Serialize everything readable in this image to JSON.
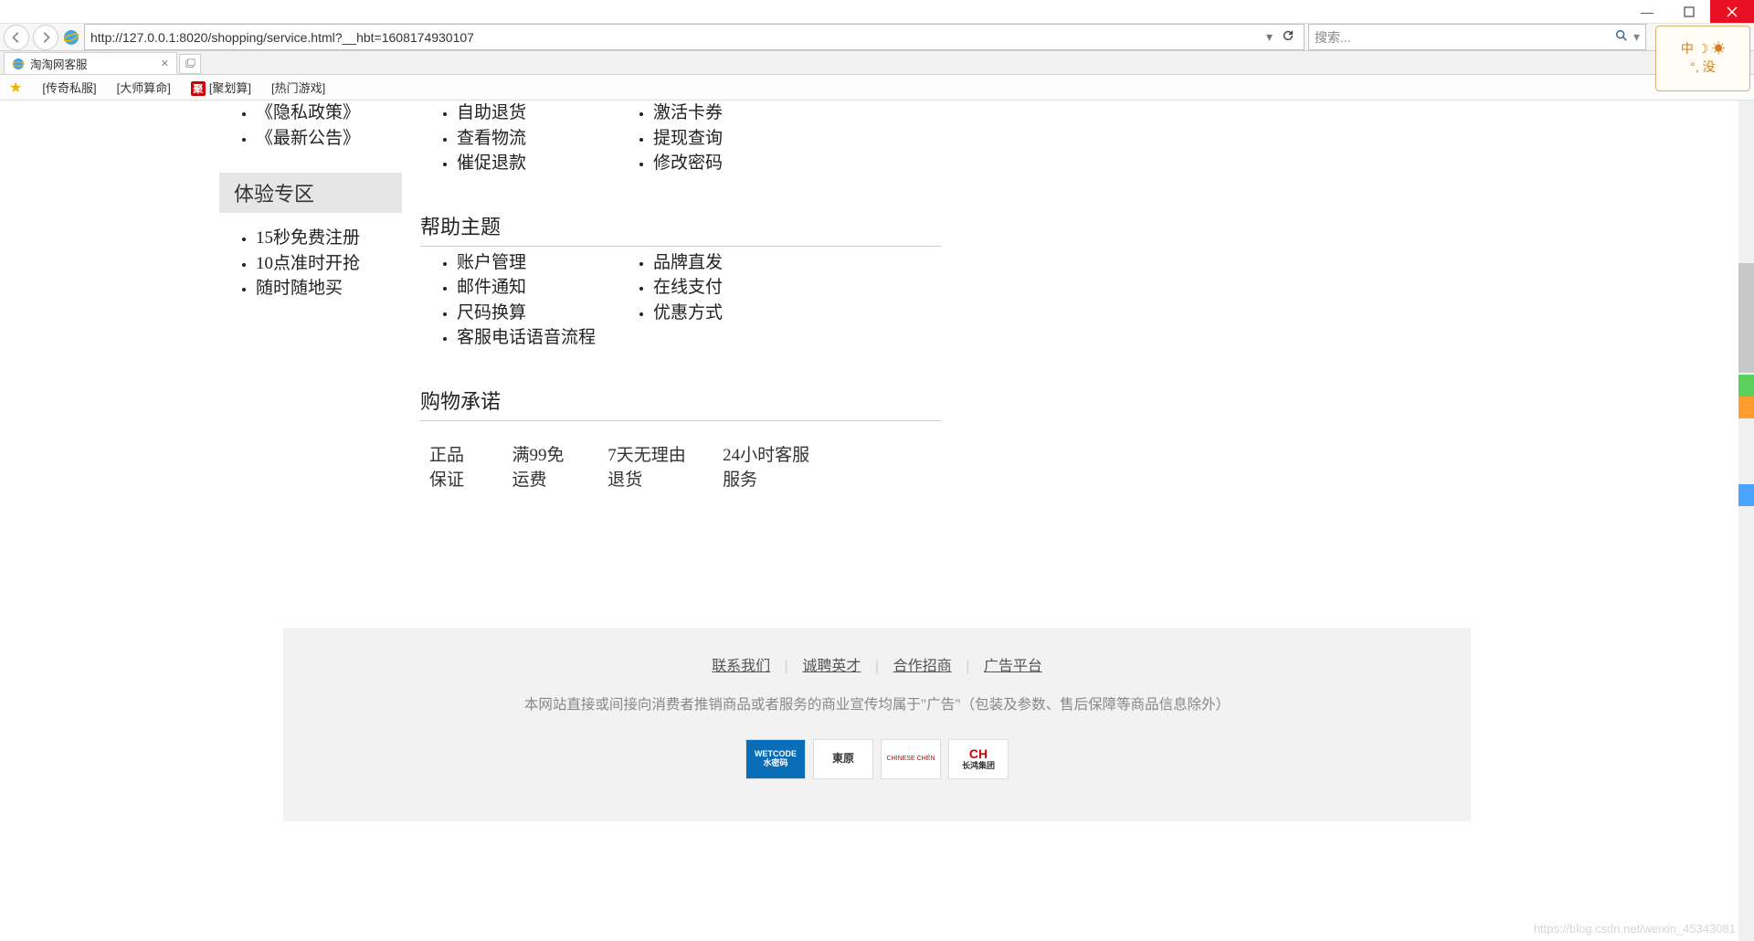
{
  "window": {
    "minimize": "–",
    "maximize": "❐",
    "close": "✕"
  },
  "nav": {
    "url": "http://127.0.0.1:8020/shopping/service.html?__hbt=1608174930107",
    "search_placeholder": "搜索..."
  },
  "tab": {
    "title": "淘淘网客服"
  },
  "bookmarks": {
    "b0": "[传奇私服]",
    "b1": "[大师算命]",
    "ju_label": "聚",
    "b2": "[聚划算]",
    "b3": "[热门游戏]"
  },
  "catbox": {
    "l1": "中 ☽ ☀",
    "l2": "°, 没"
  },
  "sidebar": {
    "list1": [
      "《隐私政策》",
      "《最新公告》"
    ],
    "exp_header": "体验专区",
    "list2": [
      "15秒免费注册",
      "10点准时开抢",
      "随时随地买"
    ]
  },
  "mid": {
    "list_top": [
      "自助退货",
      "查看物流",
      "催促退款"
    ],
    "help_title": "帮助主题",
    "help_left": [
      "账户管理",
      "邮件通知",
      "尺码换算",
      "客服电话语音流程"
    ],
    "promise_title": "购物承诺",
    "promise_items": [
      "正品保证",
      "满99免运费",
      "7天无理由退货",
      "24小时客服服务"
    ]
  },
  "right": {
    "list_top": [
      "激活卡券",
      "提现查询",
      "修改密码"
    ],
    "help_right": [
      "品牌直发",
      "在线支付",
      "优惠方式"
    ]
  },
  "footer": {
    "link0": "联系我们",
    "link1": "诚聘英才",
    "link2": "合作招商",
    "link3": "广告平台",
    "sep": "|",
    "disclaimer": "本网站直接或间接向消费者推销商品或者服务的商业宣传均属于\"广告\"（包装及参数、售后保障等商品信息除外）",
    "logos": {
      "wetcode_l1": "WETCODE",
      "wetcode_l2": "水密码",
      "dongyuan": "東原",
      "cnchn": "CHINESE CHÉN",
      "ch_l1": "CH",
      "ch_l2": "长鸿集团"
    }
  },
  "watermark": "https://blog.csdn.net/weixin_45343081"
}
